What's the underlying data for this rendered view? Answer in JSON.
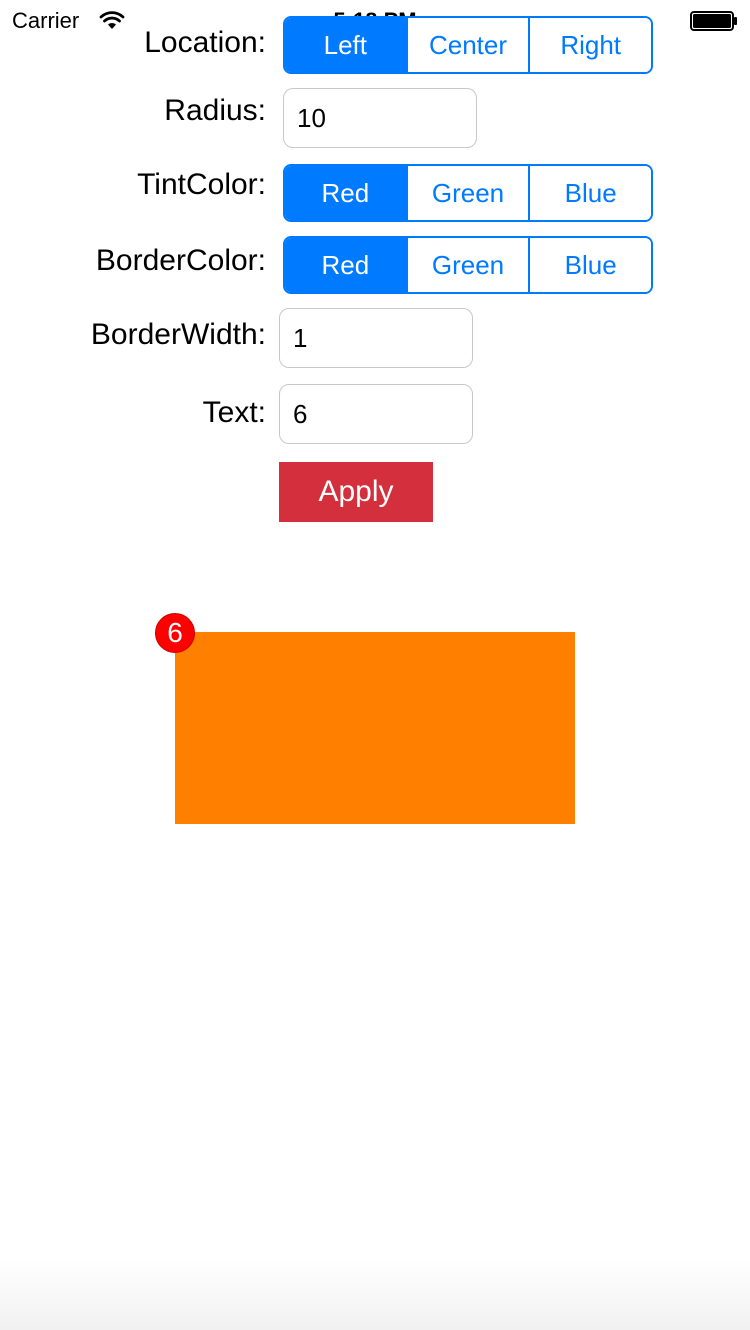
{
  "status_bar": {
    "carrier": "Carrier",
    "time": "5:18 PM",
    "wifi_icon": "wifi-icon",
    "battery_icon": "battery-icon"
  },
  "form": {
    "location": {
      "label": "Location:",
      "options": [
        "Left",
        "Center",
        "Right"
      ],
      "selected": "Left"
    },
    "radius": {
      "label": "Radius:",
      "value": "10"
    },
    "tint_color": {
      "label": "TintColor:",
      "options": [
        "Red",
        "Green",
        "Blue"
      ],
      "selected": "Red"
    },
    "border_color": {
      "label": "BorderColor:",
      "options": [
        "Red",
        "Green",
        "Blue"
      ],
      "selected": "Red"
    },
    "border_width": {
      "label": "BorderWidth:",
      "value": "1"
    },
    "text": {
      "label": "Text:",
      "value": "6"
    },
    "apply_label": "Apply"
  },
  "preview": {
    "badge_text": "6",
    "box_color": "#ff8000",
    "badge_color": "#ff0000"
  },
  "colors": {
    "accent": "#007aff",
    "apply_button": "#d32f3c"
  }
}
